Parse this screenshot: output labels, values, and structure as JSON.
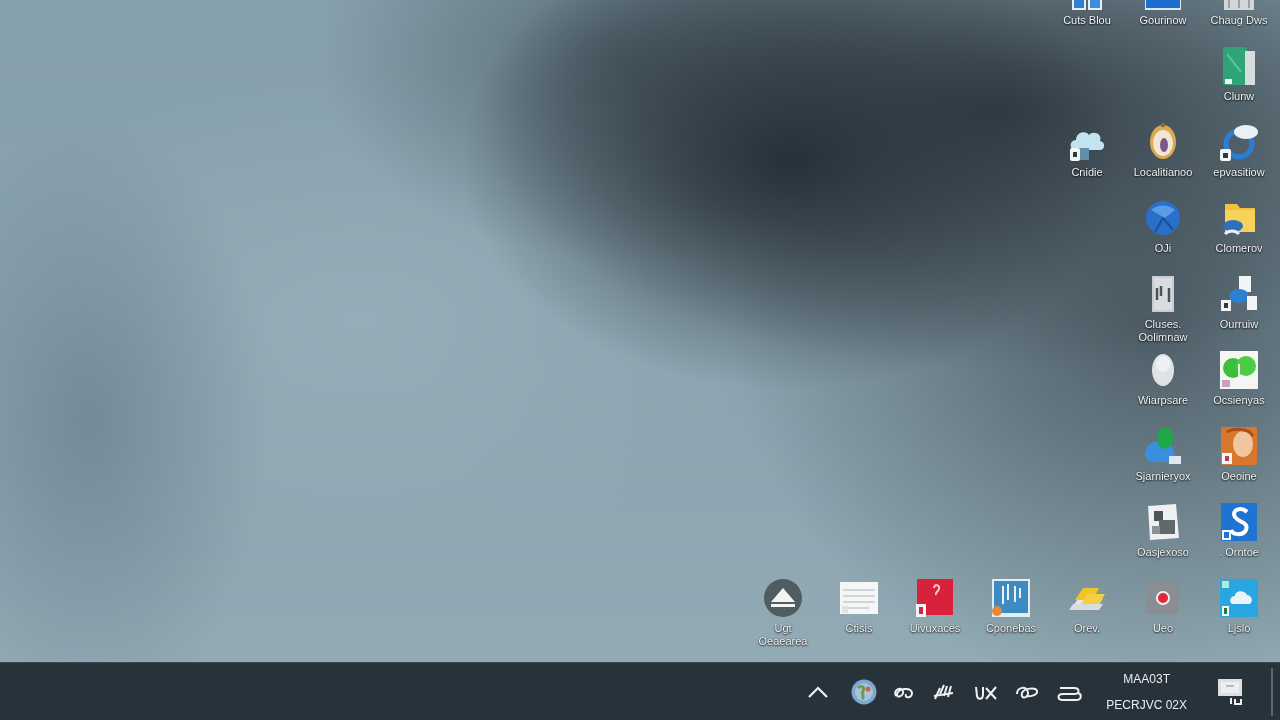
{
  "desktop_icons": [
    {
      "label": "Cuts Blou",
      "selected": false
    },
    {
      "label": "Gourinow",
      "selected": false
    },
    {
      "label": "Chaug Dws",
      "selected": false
    },
    {
      "label": "Clunw",
      "selected": false
    },
    {
      "label": "Cnidie",
      "selected": false
    },
    {
      "label": "Localitianoo",
      "selected": false
    },
    {
      "label": "epvasitiow",
      "selected": false
    },
    {
      "label": "OJi",
      "selected": false
    },
    {
      "label": "Clomerov",
      "selected": false
    },
    {
      "label": "Cluses.\nOolimnaw",
      "selected": false
    },
    {
      "label": "Ourruiw",
      "selected": false
    },
    {
      "label": "Wiarpsare",
      "selected": false
    },
    {
      "label": "Ocsienyas",
      "selected": false
    },
    {
      "label": "Sjarnieryox",
      "selected": false
    },
    {
      "label": "Oeoine",
      "selected": false
    },
    {
      "label": "Oasjexoso",
      "selected": false
    },
    {
      "label": ". Orntoe",
      "selected": false
    },
    {
      "label": "Ugt\nOeaearea",
      "selected": false
    },
    {
      "label": "Ctisis",
      "selected": false
    },
    {
      "label": "Uivuxaces",
      "selected": false
    },
    {
      "label": "Cponebas",
      "selected": false
    },
    {
      "label": "Orev.",
      "selected": false
    },
    {
      "label": "Ueo",
      "selected": false
    },
    {
      "label": "Ljslo",
      "selected": false
    }
  ],
  "taskbar": {
    "clock": {
      "line_1": "MAA03T",
      "line_2": "PECRJVC 02X"
    }
  }
}
